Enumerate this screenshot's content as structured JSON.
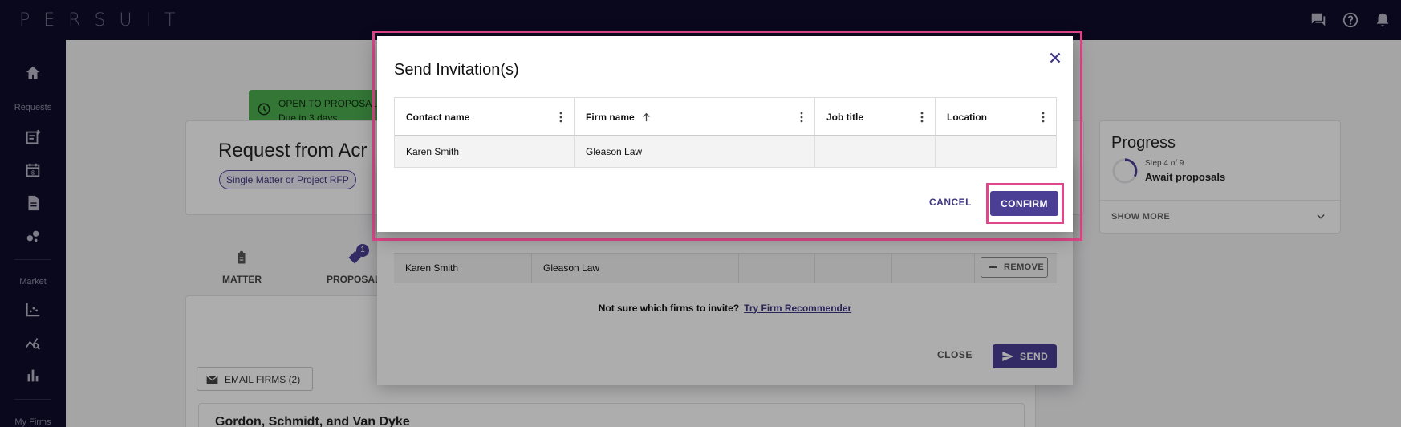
{
  "app": {
    "logo": "PERSUIT"
  },
  "sidebar": {
    "sections": [
      "Requests",
      "Market",
      "My Firms"
    ]
  },
  "status": {
    "title": "OPEN TO PROPOSALS",
    "due": "Due in 3 days"
  },
  "request": {
    "title": "Request from Acr",
    "chip": "Single Matter or Project RFP"
  },
  "tabs": [
    {
      "label": "MATTER"
    },
    {
      "label": "PROPOSAL",
      "badge": "1"
    }
  ],
  "email_firms_label": "EMAIL FIRMS (2)",
  "firm_heading": "Gordon, Schmidt, and Van Dyke",
  "progress": {
    "title": "Progress",
    "step": "Step 4 of 9",
    "stage": "Await proposals",
    "show_more": "SHOW MORE"
  },
  "background_dialog": {
    "row": {
      "contact": "Karen Smith",
      "firm": "Gleason Law"
    },
    "remove_label": "REMOVE",
    "not_sure": "Not sure which firms to invite?",
    "recommender_link": "Try Firm Recommender",
    "close_label": "CLOSE",
    "send_label": "SEND"
  },
  "dialog": {
    "title": "Send Invitation(s)",
    "columns": [
      "Contact name",
      "Firm name",
      "Job title",
      "Location"
    ],
    "rows": [
      {
        "contact": "Karen Smith",
        "firm": "Gleason Law",
        "job_title": "",
        "location": ""
      }
    ],
    "cancel_label": "CANCEL",
    "confirm_label": "CONFIRM"
  },
  "colors": {
    "accent": "#4a3f94",
    "highlight": "#e0468a",
    "nav_bg": "#100d2a",
    "status_green": "#4caf50"
  }
}
